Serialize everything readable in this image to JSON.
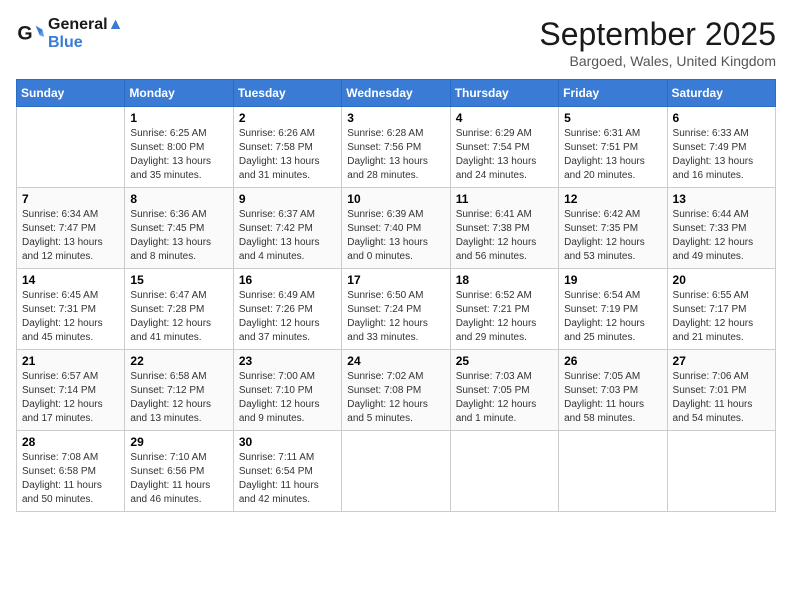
{
  "header": {
    "logo_line1": "General",
    "logo_line2": "Blue",
    "month": "September 2025",
    "location": "Bargoed, Wales, United Kingdom"
  },
  "days": [
    "Sunday",
    "Monday",
    "Tuesday",
    "Wednesday",
    "Thursday",
    "Friday",
    "Saturday"
  ],
  "weeks": [
    [
      {
        "date": "",
        "info": ""
      },
      {
        "date": "1",
        "info": "Sunrise: 6:25 AM\nSunset: 8:00 PM\nDaylight: 13 hours\nand 35 minutes."
      },
      {
        "date": "2",
        "info": "Sunrise: 6:26 AM\nSunset: 7:58 PM\nDaylight: 13 hours\nand 31 minutes."
      },
      {
        "date": "3",
        "info": "Sunrise: 6:28 AM\nSunset: 7:56 PM\nDaylight: 13 hours\nand 28 minutes."
      },
      {
        "date": "4",
        "info": "Sunrise: 6:29 AM\nSunset: 7:54 PM\nDaylight: 13 hours\nand 24 minutes."
      },
      {
        "date": "5",
        "info": "Sunrise: 6:31 AM\nSunset: 7:51 PM\nDaylight: 13 hours\nand 20 minutes."
      },
      {
        "date": "6",
        "info": "Sunrise: 6:33 AM\nSunset: 7:49 PM\nDaylight: 13 hours\nand 16 minutes."
      }
    ],
    [
      {
        "date": "7",
        "info": "Sunrise: 6:34 AM\nSunset: 7:47 PM\nDaylight: 13 hours\nand 12 minutes."
      },
      {
        "date": "8",
        "info": "Sunrise: 6:36 AM\nSunset: 7:45 PM\nDaylight: 13 hours\nand 8 minutes."
      },
      {
        "date": "9",
        "info": "Sunrise: 6:37 AM\nSunset: 7:42 PM\nDaylight: 13 hours\nand 4 minutes."
      },
      {
        "date": "10",
        "info": "Sunrise: 6:39 AM\nSunset: 7:40 PM\nDaylight: 13 hours\nand 0 minutes."
      },
      {
        "date": "11",
        "info": "Sunrise: 6:41 AM\nSunset: 7:38 PM\nDaylight: 12 hours\nand 56 minutes."
      },
      {
        "date": "12",
        "info": "Sunrise: 6:42 AM\nSunset: 7:35 PM\nDaylight: 12 hours\nand 53 minutes."
      },
      {
        "date": "13",
        "info": "Sunrise: 6:44 AM\nSunset: 7:33 PM\nDaylight: 12 hours\nand 49 minutes."
      }
    ],
    [
      {
        "date": "14",
        "info": "Sunrise: 6:45 AM\nSunset: 7:31 PM\nDaylight: 12 hours\nand 45 minutes."
      },
      {
        "date": "15",
        "info": "Sunrise: 6:47 AM\nSunset: 7:28 PM\nDaylight: 12 hours\nand 41 minutes."
      },
      {
        "date": "16",
        "info": "Sunrise: 6:49 AM\nSunset: 7:26 PM\nDaylight: 12 hours\nand 37 minutes."
      },
      {
        "date": "17",
        "info": "Sunrise: 6:50 AM\nSunset: 7:24 PM\nDaylight: 12 hours\nand 33 minutes."
      },
      {
        "date": "18",
        "info": "Sunrise: 6:52 AM\nSunset: 7:21 PM\nDaylight: 12 hours\nand 29 minutes."
      },
      {
        "date": "19",
        "info": "Sunrise: 6:54 AM\nSunset: 7:19 PM\nDaylight: 12 hours\nand 25 minutes."
      },
      {
        "date": "20",
        "info": "Sunrise: 6:55 AM\nSunset: 7:17 PM\nDaylight: 12 hours\nand 21 minutes."
      }
    ],
    [
      {
        "date": "21",
        "info": "Sunrise: 6:57 AM\nSunset: 7:14 PM\nDaylight: 12 hours\nand 17 minutes."
      },
      {
        "date": "22",
        "info": "Sunrise: 6:58 AM\nSunset: 7:12 PM\nDaylight: 12 hours\nand 13 minutes."
      },
      {
        "date": "23",
        "info": "Sunrise: 7:00 AM\nSunset: 7:10 PM\nDaylight: 12 hours\nand 9 minutes."
      },
      {
        "date": "24",
        "info": "Sunrise: 7:02 AM\nSunset: 7:08 PM\nDaylight: 12 hours\nand 5 minutes."
      },
      {
        "date": "25",
        "info": "Sunrise: 7:03 AM\nSunset: 7:05 PM\nDaylight: 12 hours\nand 1 minute."
      },
      {
        "date": "26",
        "info": "Sunrise: 7:05 AM\nSunset: 7:03 PM\nDaylight: 11 hours\nand 58 minutes."
      },
      {
        "date": "27",
        "info": "Sunrise: 7:06 AM\nSunset: 7:01 PM\nDaylight: 11 hours\nand 54 minutes."
      }
    ],
    [
      {
        "date": "28",
        "info": "Sunrise: 7:08 AM\nSunset: 6:58 PM\nDaylight: 11 hours\nand 50 minutes."
      },
      {
        "date": "29",
        "info": "Sunrise: 7:10 AM\nSunset: 6:56 PM\nDaylight: 11 hours\nand 46 minutes."
      },
      {
        "date": "30",
        "info": "Sunrise: 7:11 AM\nSunset: 6:54 PM\nDaylight: 11 hours\nand 42 minutes."
      },
      {
        "date": "",
        "info": ""
      },
      {
        "date": "",
        "info": ""
      },
      {
        "date": "",
        "info": ""
      },
      {
        "date": "",
        "info": ""
      }
    ]
  ]
}
